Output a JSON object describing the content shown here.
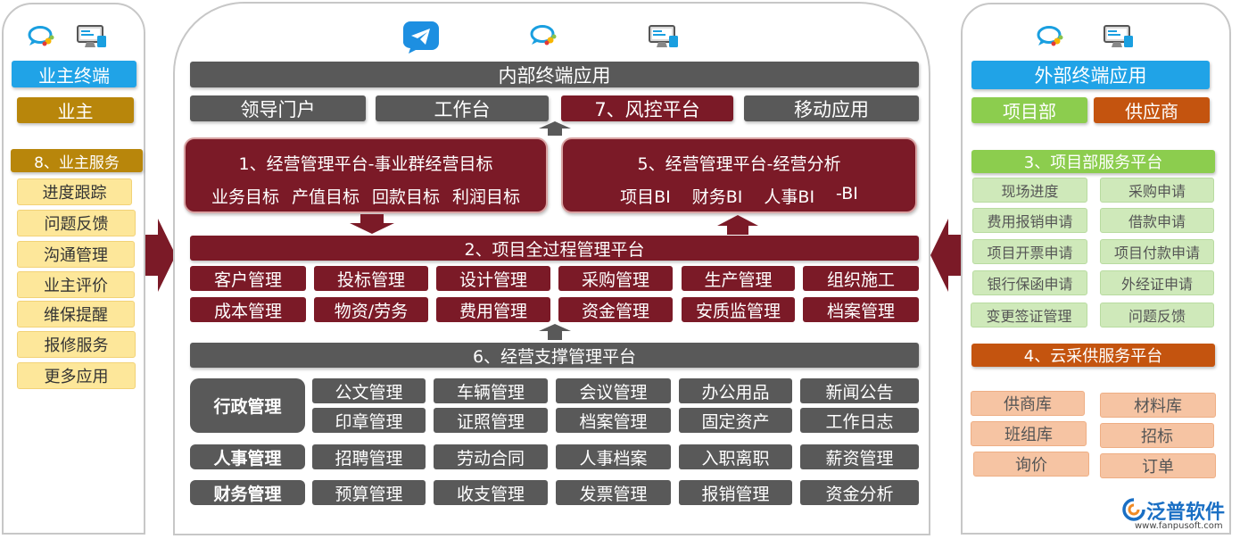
{
  "left": {
    "terminal_title": "业主终端",
    "owner": "业主",
    "service_title": "8、业主服务",
    "services": [
      "进度跟踪",
      "问题反馈",
      "沟通管理",
      "业主评价",
      "维保提醒",
      "报修服务",
      "更多应用"
    ]
  },
  "center": {
    "internal_title": "内部终端应用",
    "tabs": [
      "领导门户",
      "工作台",
      "7、风控平台",
      "移动应用"
    ],
    "platform1": {
      "title": "1、经营管理平台-事业群经营目标",
      "items": [
        "业务目标",
        "产值目标",
        "回款目标",
        "利润目标"
      ]
    },
    "platform5": {
      "title": "5、经营管理平台-经营分析",
      "items": [
        "项目BI",
        "财务BI",
        "人事BI",
        "-BI"
      ]
    },
    "platform2": {
      "title": "2、项目全过程管理平台",
      "row1": [
        "客户管理",
        "投标管理",
        "设计管理",
        "采购管理",
        "生产管理",
        "组织施工"
      ],
      "row2": [
        "成本管理",
        "物资/劳务",
        "费用管理",
        "资金管理",
        "安质监管理",
        "档案管理"
      ]
    },
    "platform6": {
      "title": "6、经营支撑管理平台",
      "admin": {
        "label": "行政管理",
        "row1": [
          "公文管理",
          "车辆管理",
          "会议管理",
          "办公用品",
          "新闻公告"
        ],
        "row2": [
          "印章管理",
          "证照管理",
          "档案管理",
          "固定资产",
          "工作日志"
        ]
      },
      "hr": {
        "label": "人事管理",
        "row": [
          "招聘管理",
          "劳动合同",
          "人事档案",
          "入职离职",
          "薪资管理"
        ]
      },
      "finance": {
        "label": "财务管理",
        "row": [
          "预算管理",
          "收支管理",
          "发票管理",
          "报销管理",
          "资金分析"
        ]
      }
    }
  },
  "right": {
    "terminal_title": "外部终端应用",
    "project_dept": "项目部",
    "supplier": "供应商",
    "platform3": {
      "title": "3、项目部服务平台",
      "left": [
        "现场进度",
        "费用报销申请",
        "项目开票申请",
        "银行保函申请",
        "变更签证管理"
      ],
      "right": [
        "采购申请",
        "借款申请",
        "项目付款申请",
        "外经证申请",
        "问题反馈"
      ]
    },
    "platform4": {
      "title": "4、云采供服务平台",
      "left": [
        "供商库",
        "班组库",
        "询价"
      ],
      "right": [
        "材料库",
        "招标",
        "订单"
      ]
    }
  },
  "logo": {
    "name": "泛普软件",
    "url": "www.fanpusoft.com"
  },
  "colors": {
    "gray": "#595959",
    "maroon": "#7b1a27",
    "blue": "#20a3e7",
    "gold": "#b8860b",
    "green": "#8ccd4e",
    "orange": "#c4540f"
  },
  "icons": [
    "chat-icon",
    "computer-icon",
    "plane-icon"
  ]
}
